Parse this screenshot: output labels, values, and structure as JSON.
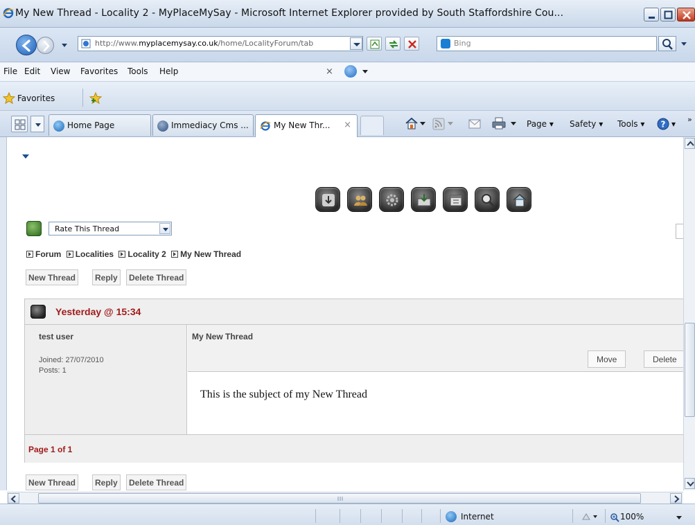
{
  "window": {
    "title": "My New Thread - Locality 2 - MyPlaceMySay - Microsoft Internet Explorer provided by South Staffordshire Cou..."
  },
  "address": {
    "url_prefix": "http://www.",
    "url_domain": "myplacemysay.co.uk",
    "url_path": "/home/LocalityForum/tab",
    "search_placeholder": "Bing"
  },
  "menu": {
    "items": [
      "File",
      "Edit",
      "View",
      "Favorites",
      "Tools",
      "Help"
    ],
    "close_glyph": "×"
  },
  "favorites_bar": {
    "label": "Favorites"
  },
  "tabs": [
    {
      "label": "Home Page",
      "icon": "home-page-icon"
    },
    {
      "label": "Immediacy Cms ...",
      "icon": "cms-icon"
    },
    {
      "label": "My New Thr...",
      "icon": "ie-icon",
      "active": true,
      "close": "×"
    }
  ],
  "command_bar": {
    "page": "Page ▾",
    "safety": "Safety ▾",
    "tools": "Tools ▾",
    "help_dd": "▾",
    "overflow": "»"
  },
  "forum": {
    "rate_select_value": "Rate This Thread",
    "breadcrumb": [
      "Forum",
      "Localities",
      "Locality 2",
      "My New Thread"
    ],
    "buttons": {
      "new_thread": "New Thread",
      "reply": "Reply",
      "delete_thread": "Delete Thread"
    },
    "post": {
      "date": "Yesterday @ 15:34",
      "username": "test user",
      "joined": "Joined: 27/07/2010",
      "posts": "Posts: 1",
      "subject": "My New Thread",
      "move_label": "Move",
      "delete_label": "Delete",
      "message": "This is the subject of my New Thread"
    },
    "pagination": "Page 1 of 1"
  },
  "status": {
    "zone": "Internet",
    "zoom": "100%"
  },
  "colors": {
    "accent_red": "#a11b1b",
    "ie_blue": "#1d5fb6"
  }
}
